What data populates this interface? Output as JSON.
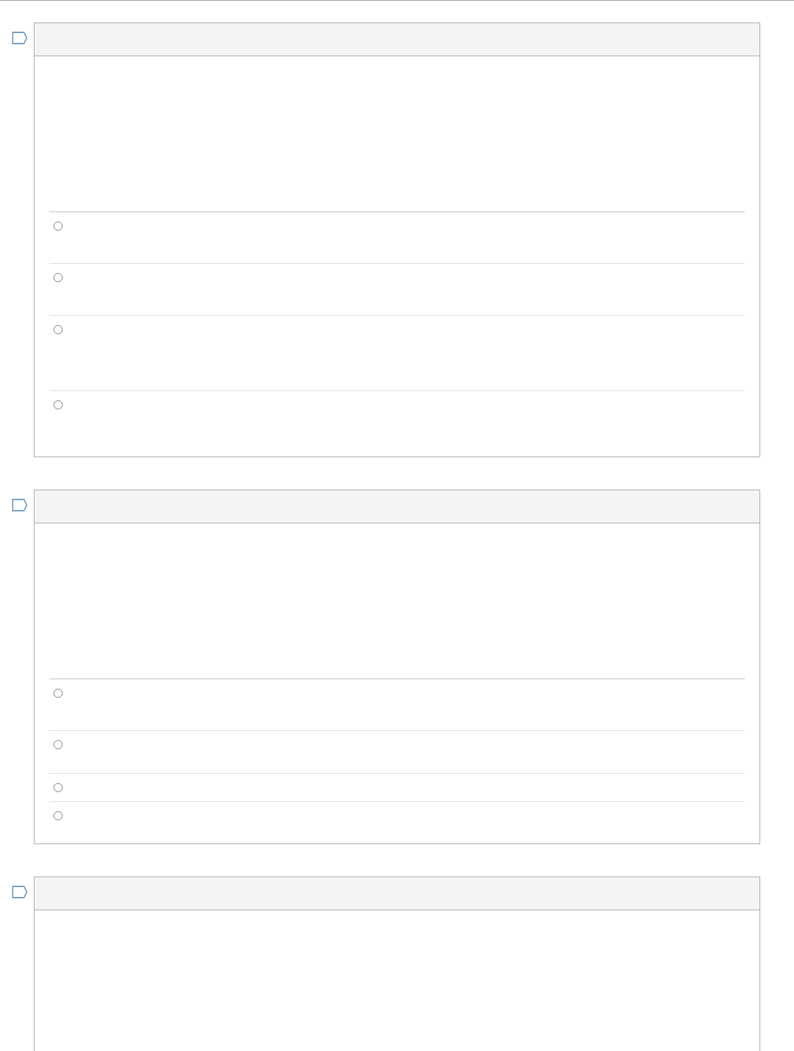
{
  "questions": [
    {
      "flagged": false,
      "options": [
        {
          "selected": false
        },
        {
          "selected": false
        },
        {
          "selected": false
        },
        {
          "selected": false
        }
      ]
    },
    {
      "flagged": false,
      "options": [
        {
          "selected": false
        },
        {
          "selected": false
        },
        {
          "selected": false
        },
        {
          "selected": false
        }
      ]
    },
    {
      "flagged": false
    }
  ]
}
